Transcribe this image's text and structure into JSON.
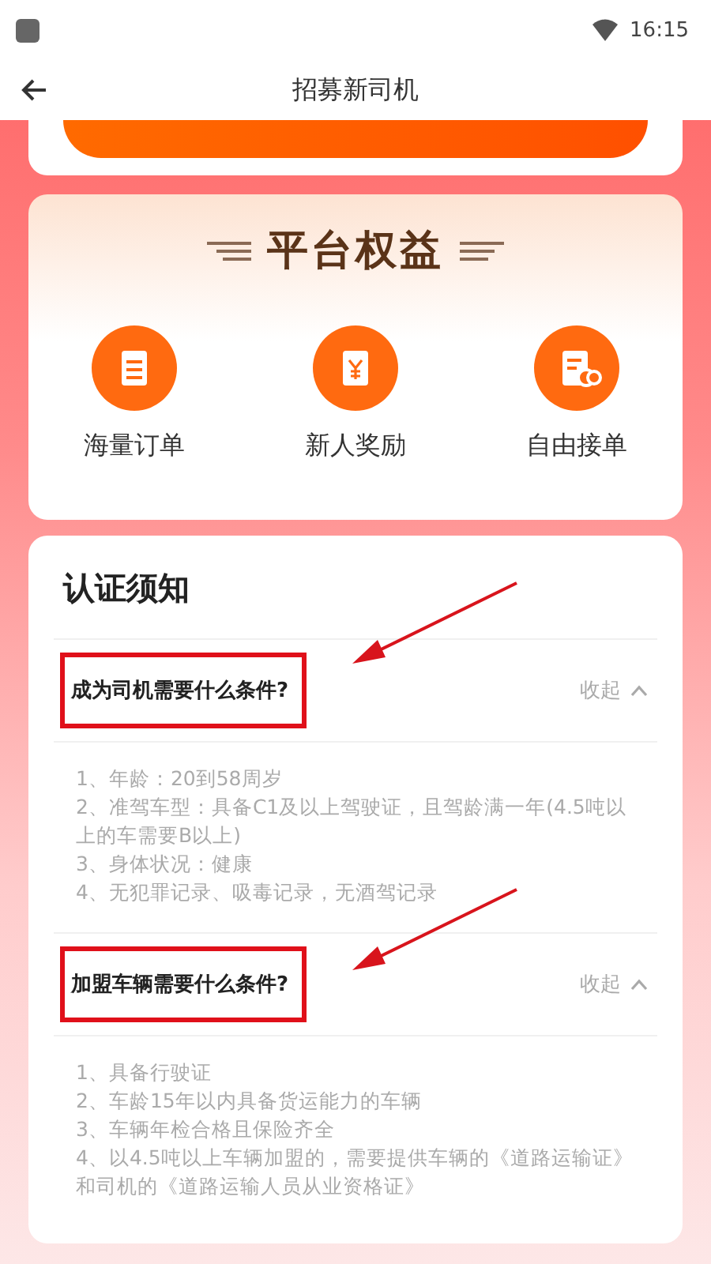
{
  "status_bar": {
    "time": "16:15"
  },
  "header": {
    "title": "招募新司机"
  },
  "benefits": {
    "title": "平台权益",
    "items": [
      {
        "kind": "orders",
        "label": "海量订单"
      },
      {
        "kind": "reward",
        "label": "新人奖励"
      },
      {
        "kind": "free",
        "label": "自由接单"
      }
    ]
  },
  "notice": {
    "title": "认证须知",
    "faqs": [
      {
        "question": "成为司机需要什么条件?",
        "toggle": "收起",
        "expanded": true,
        "highlighted": true,
        "answers": [
          "1、年龄：20到58周岁",
          "2、准驾车型：具备C1及以上驾驶证，且驾龄满一年(4.5吨以上的车需要B以上)",
          "3、身体状况：健康",
          "4、无犯罪记录、吸毒记录，无酒驾记录"
        ]
      },
      {
        "question": "加盟车辆需要什么条件?",
        "toggle": "收起",
        "expanded": true,
        "highlighted": true,
        "answers": [
          "1、具备行驶证",
          "2、车龄15年以内具备货运能力的车辆",
          "3、车辆年检合格且保险齐全",
          "4、以4.5吨以上车辆加盟的，需要提供车辆的《道路运输证》和司机的《道路运输人员从业资格证》"
        ]
      }
    ]
  }
}
